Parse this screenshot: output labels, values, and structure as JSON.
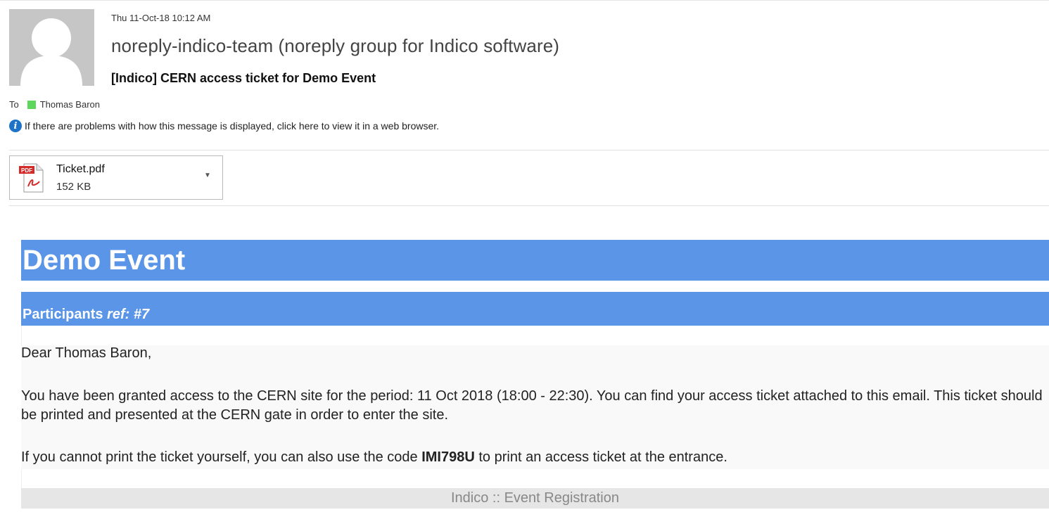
{
  "header": {
    "date": "Thu 11-Oct-18 10:12 AM",
    "sender": "noreply-indico-team (noreply group for Indico software)",
    "subject": "[Indico] CERN access ticket for Demo Event",
    "to_label": "To",
    "recipient": "Thomas Baron",
    "info_text": "If there are problems with how this message is displayed, click here to view it in a web browser."
  },
  "attachment": {
    "name": "Ticket.pdf",
    "size": "152 KB",
    "type_label": "PDF"
  },
  "message": {
    "event_title": "Demo Event",
    "section_title": "Participants",
    "ref": "ref: #7",
    "greeting": "Dear Thomas Baron,",
    "paragraph1": "You have been granted access to the CERN site for the period: 11 Oct 2018 (18:00 - 22:30). You can find your access ticket attached to this email. This ticket should be printed and presented at the CERN gate in order to enter the site.",
    "paragraph2_before": "If you cannot print the ticket yourself, you can also use the code ",
    "code": "IMI798U",
    "paragraph2_after": " to print an access ticket at the entrance.",
    "footer": "Indico :: Event Registration"
  },
  "colors": {
    "banner": "#5b95e8",
    "presence": "#5cd65c",
    "info_icon": "#1e73c9"
  }
}
